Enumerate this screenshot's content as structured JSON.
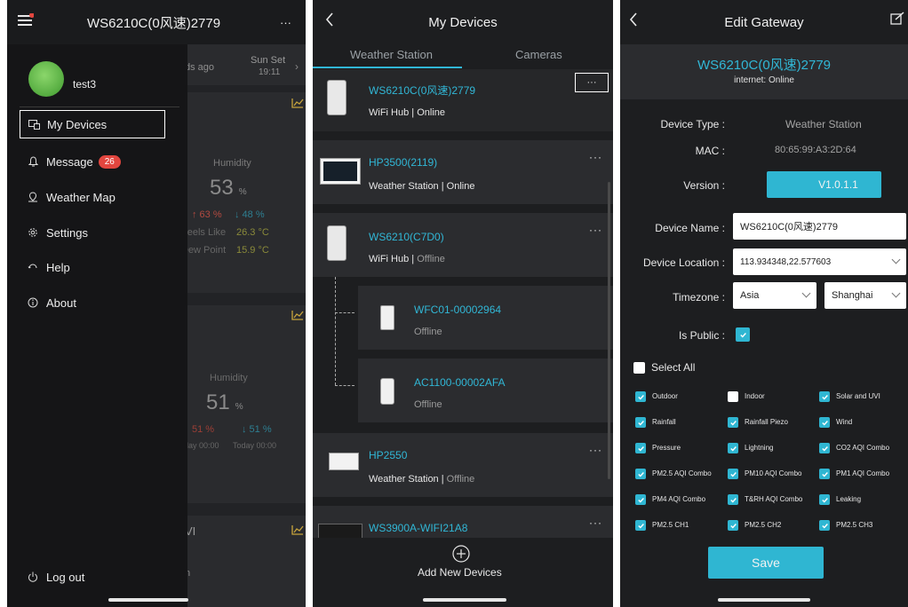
{
  "panel1": {
    "title": "WS6210C(0风速)2779",
    "more": "···",
    "username": "test3",
    "menu": [
      {
        "label": "My Devices",
        "icon": "devices-icon"
      },
      {
        "label": "Message",
        "icon": "bell-icon",
        "badge": "26"
      },
      {
        "label": "Weather Map",
        "icon": "map-pin-icon"
      },
      {
        "label": "Settings",
        "icon": "gear-icon"
      },
      {
        "label": "Help",
        "icon": "help-icon"
      },
      {
        "label": "About",
        "icon": "info-icon"
      }
    ],
    "logout": "Log out",
    "background": {
      "ago": "ds ago",
      "sunset_label": "Sun Set",
      "sunset_time": "19:11",
      "humidity_label_1": "Humidity",
      "humidity_value_1": "53",
      "humidity_unit_1": "%",
      "hi_lo_1": "↑ 63 %   ↓ 48 %",
      "hi_1": "↑ 63 %",
      "lo_1": "↓ 48 %",
      "feels_like_label": "Feels Like",
      "feels_like_value": "26.3 °C",
      "dew_point_label": "Dew Point",
      "dew_point_value": "15.9 °C",
      "humidity_label_2": "Humidity",
      "humidity_value_2": "51",
      "humidity_unit_2": "%",
      "hi_2": "51 %",
      "lo_2": "↓ 51 %",
      "time_1": "lay 00:00",
      "time_2": "Today 00:00",
      "vi_label": "VI",
      "n_label": "n"
    }
  },
  "panel2": {
    "title": "My Devices",
    "tabs": [
      "Weather Station",
      "Cameras"
    ],
    "devices": [
      {
        "name": "WS6210C(0风速)2779",
        "type": "WiFi Hub",
        "status": "Online"
      },
      {
        "name": "HP3500(2119)",
        "type": "Weather Station",
        "status": "Online"
      },
      {
        "name": "WS6210(C7D0)",
        "type": "WiFi Hub",
        "status": "Offline"
      },
      {
        "name": "WFC01-00002964",
        "status": "Offline"
      },
      {
        "name": "AC1100-00002AFA",
        "status": "Offline"
      },
      {
        "name": "HP2550",
        "type": "Weather Station",
        "status": "Offline"
      },
      {
        "name": "WS3900A-WIFI21A8"
      }
    ],
    "add_label": "Add New Devices",
    "more": "···"
  },
  "panel3": {
    "title": "Edit Gateway",
    "gateway_name": "WS6210C(0风速)2779",
    "internet_status": "internet: Online",
    "device_type_label": "Device Type :",
    "device_type_value": "Weather Station",
    "mac_label": "MAC :",
    "mac_value": "80:65:99:A3:2D:64",
    "version_label": "Version :",
    "version_value": "V1.0.1.1",
    "device_name_label": "Device Name :",
    "device_name_value": "WS6210C(0风速)2779",
    "location_label": "Device Location :",
    "location_value": "113.934348,22.577603",
    "timezone_label": "Timezone :",
    "timezone_region": "Asia",
    "timezone_city": "Shanghai",
    "public_label": "Is Public :",
    "select_all": "Select All",
    "options": [
      {
        "label": "Outdoor",
        "checked": true
      },
      {
        "label": "Indoor",
        "checked": false
      },
      {
        "label": "Solar and UVI",
        "checked": true
      },
      {
        "label": "Rainfall",
        "checked": true
      },
      {
        "label": "Rainfall Piezo",
        "checked": true
      },
      {
        "label": "Wind",
        "checked": true
      },
      {
        "label": "Pressure",
        "checked": true
      },
      {
        "label": "Lightning",
        "checked": true
      },
      {
        "label": "CO2 AQI Combo",
        "checked": true
      },
      {
        "label": "PM2.5 AQI Combo",
        "checked": true
      },
      {
        "label": "PM10 AQI Combo",
        "checked": true
      },
      {
        "label": "PM1 AQI Combo",
        "checked": true
      },
      {
        "label": "PM4 AQI Combo",
        "checked": true
      },
      {
        "label": "T&RH AQI Combo",
        "checked": true
      },
      {
        "label": "Leaking",
        "checked": true
      },
      {
        "label": "PM2.5 CH1",
        "checked": true
      },
      {
        "label": "PM2.5 CH2",
        "checked": true
      },
      {
        "label": "PM2.5 CH3",
        "checked": true
      }
    ],
    "save_label": "Save"
  },
  "colors": {
    "accent": "#2fb6d2",
    "link": "#31b7d6",
    "badge": "#e2463f",
    "panel_bg": "#1d1e20",
    "card_bg": "#2b2c2f"
  }
}
